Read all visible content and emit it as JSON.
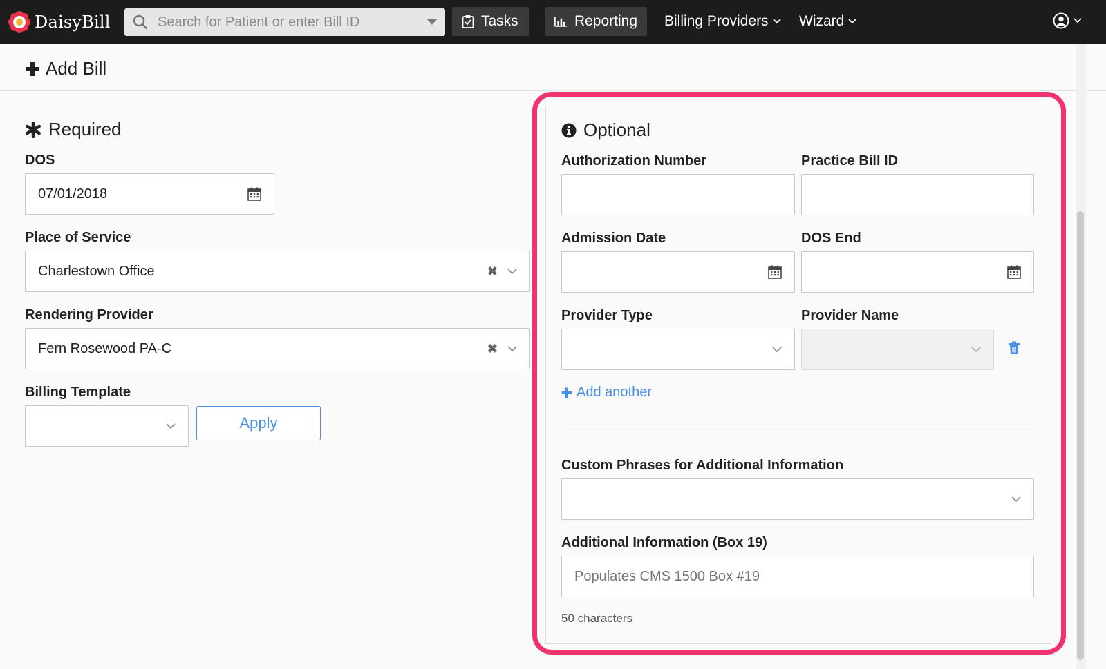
{
  "navbar": {
    "brand": "DaisyBill",
    "search_placeholder": "Search for Patient or enter Bill ID",
    "tasks": "Tasks",
    "reporting": "Reporting",
    "billing_providers": "Billing Providers",
    "wizard": "Wizard"
  },
  "page": {
    "title": "Add Bill"
  },
  "required": {
    "title": "Required",
    "dos_label": "DOS",
    "dos_value": "07/01/2018",
    "place_label": "Place of Service",
    "place_value": "Charlestown Office",
    "rendering_label": "Rendering Provider",
    "rendering_value": "Fern Rosewood PA-C",
    "template_label": "Billing Template",
    "template_value": "",
    "apply": "Apply"
  },
  "optional": {
    "title": "Optional",
    "auth_label": "Authorization Number",
    "auth_value": "",
    "practice_label": "Practice Bill ID",
    "practice_value": "",
    "admission_label": "Admission Date",
    "admission_value": "",
    "dos_end_label": "DOS End",
    "dos_end_value": "",
    "provider_type_label": "Provider Type",
    "provider_type_value": "",
    "provider_name_label": "Provider Name",
    "provider_name_value": "",
    "add_another": "Add another",
    "custom_phrases_label": "Custom Phrases for Additional Information",
    "custom_phrases_value": "",
    "additional_label": "Additional Information (Box 19)",
    "additional_placeholder": "Populates CMS 1500 Box #19",
    "char_count": "50 characters"
  },
  "colors": {
    "navbar": "#1c1c1c",
    "accent": "#4a90e2",
    "highlight": "#f0326f"
  }
}
